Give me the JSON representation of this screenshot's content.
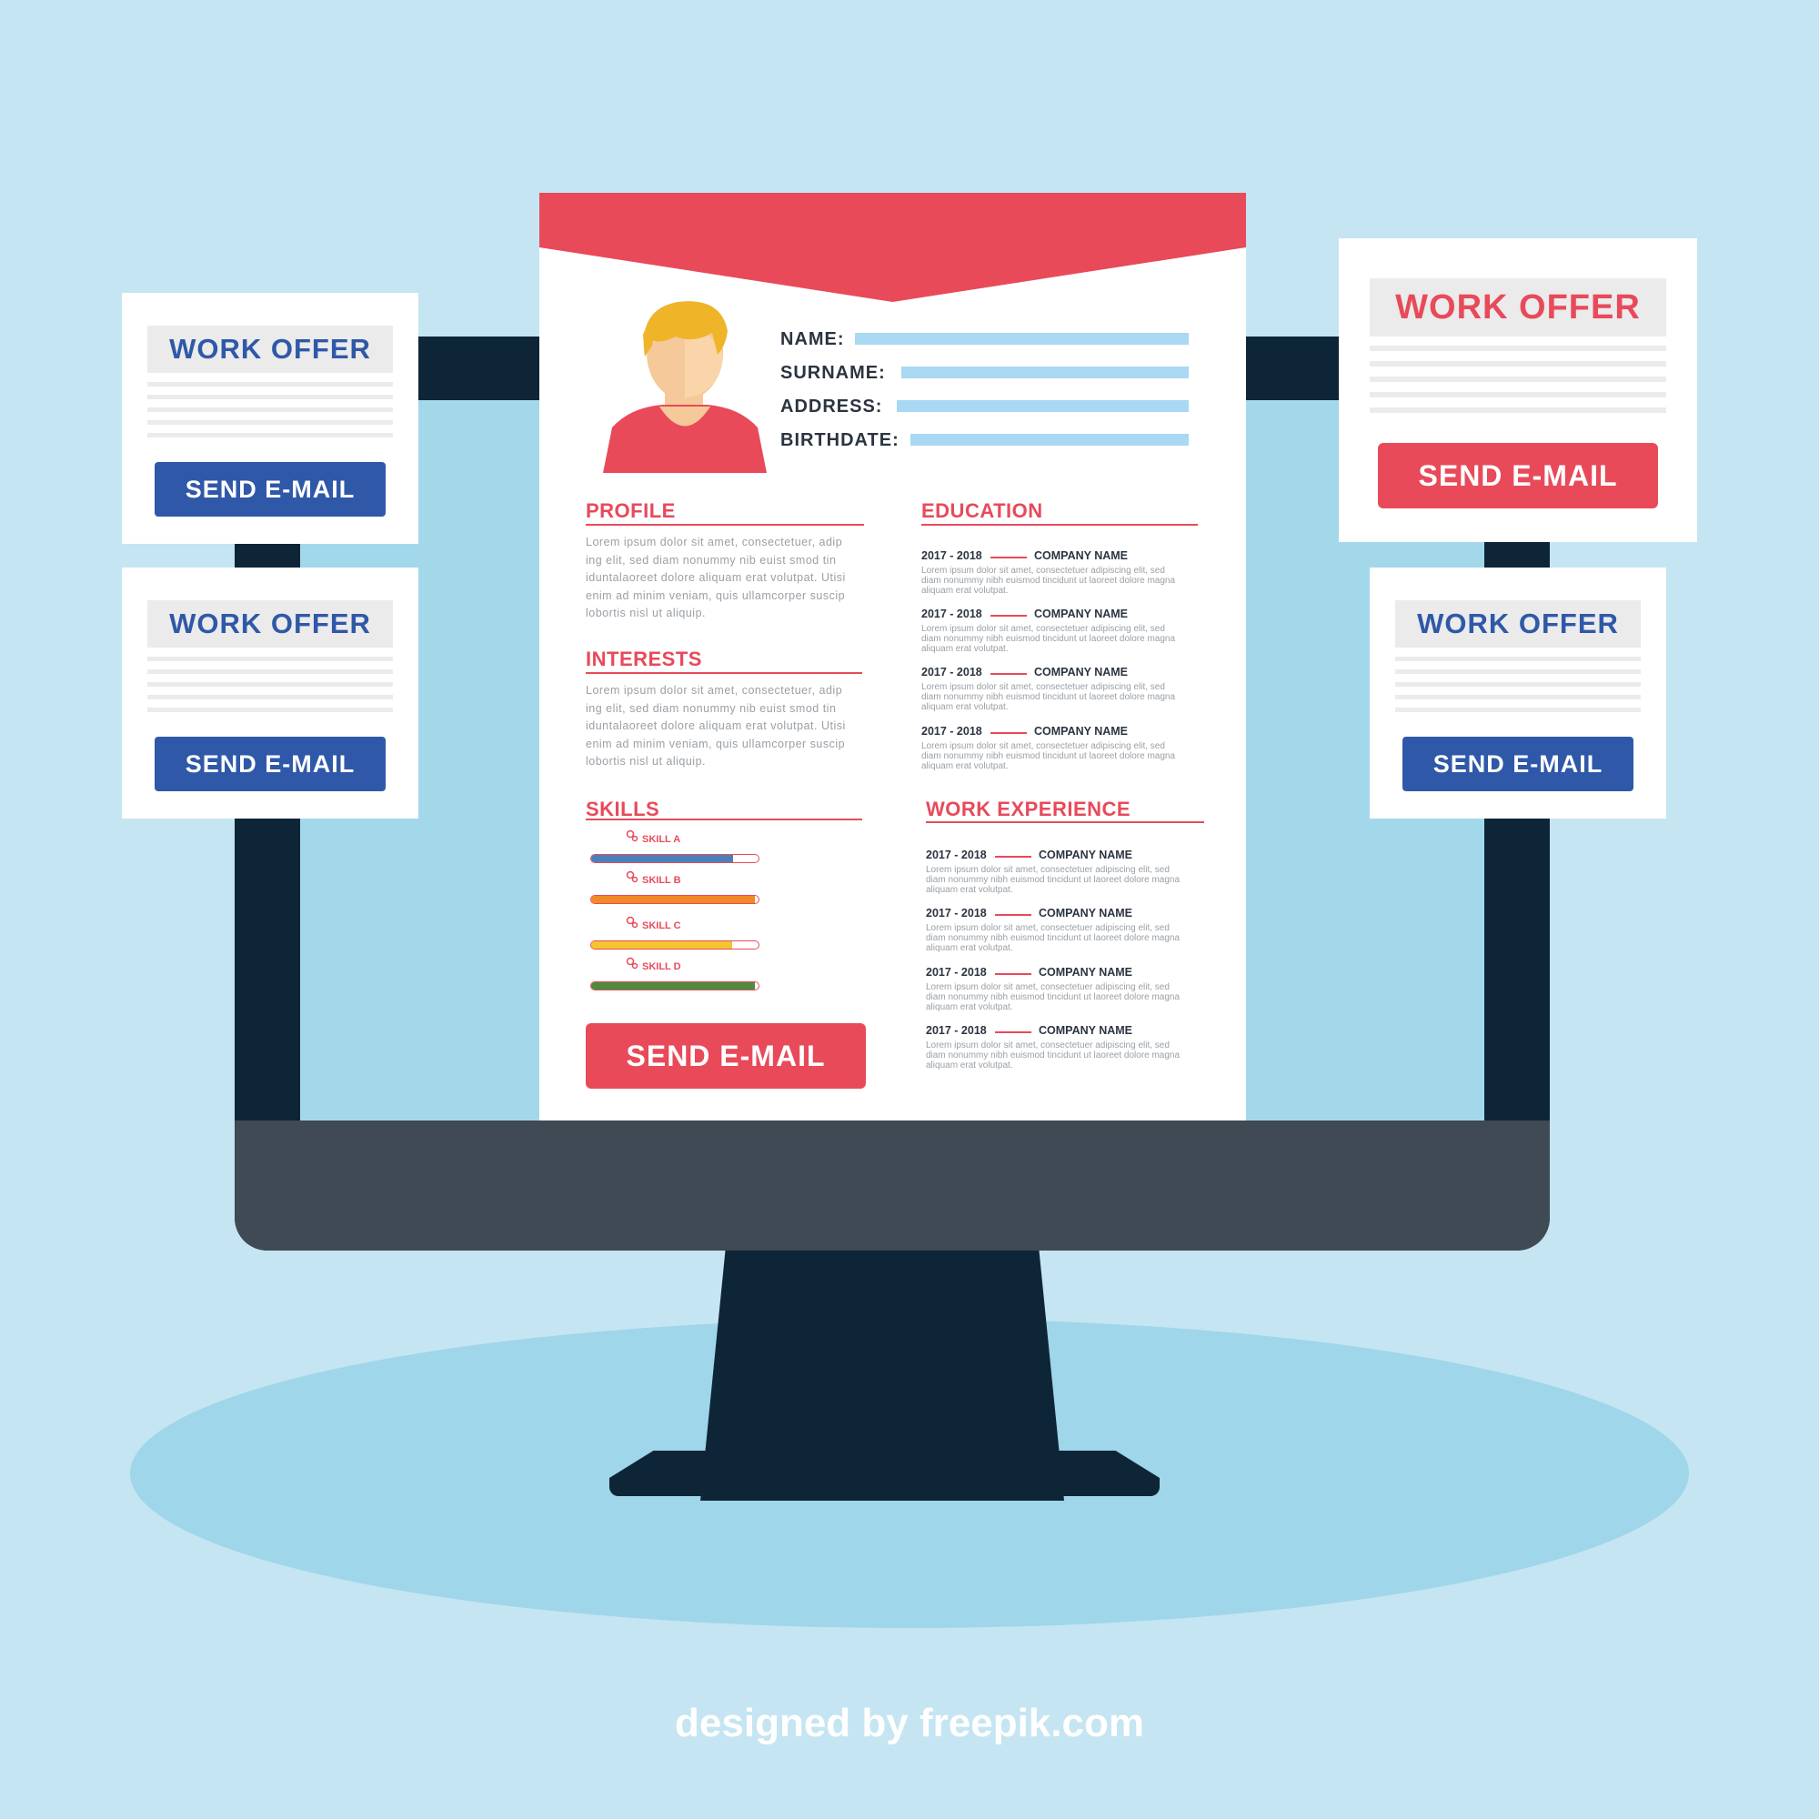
{
  "resume": {
    "fields": [
      {
        "label": "NAME:"
      },
      {
        "label": "SURNAME:"
      },
      {
        "label": "ADDRESS:"
      },
      {
        "label": "BIRTHDATE:"
      }
    ],
    "profile": {
      "title": "PROFILE",
      "lines": [
        "Lorem ipsum dolor sit amet, consectetuer, adip",
        "ing elit, sed diam nonummy nib  euist smod tin",
        "iduntalaoreet dolore aliquam erat volutpat. Utisi",
        "enim ad minim veniam, quis ullamcorper suscip",
        "lobortis nisl ut aliquip."
      ]
    },
    "interests": {
      "title": "INTERESTS",
      "lines": [
        "Lorem ipsum dolor sit amet, consectetuer, adip",
        "ing elit, sed diam nonummy nib  euist smod tin",
        "iduntalaoreet dolore aliquam erat volutpat. Utisi",
        "enim ad minim veniam, quis ullamcorper suscip",
        "lobortis nisl ut aliquip."
      ]
    },
    "skills": {
      "title": "SKILLS",
      "items": [
        {
          "label": "SKILL A",
          "level": 0.85,
          "color": "#4a7fb9"
        },
        {
          "label": "SKILL B",
          "level": 0.98,
          "color": "#f08a24"
        },
        {
          "label": "SKILL C",
          "level": 0.84,
          "color": "#f5c52e"
        },
        {
          "label": "SKILL D",
          "level": 0.98,
          "color": "#4f8a3d"
        }
      ]
    },
    "send_button": "SEND E-MAIL",
    "education": {
      "title": "EDUCATION",
      "entries": [
        {
          "year": "2017 - 2018",
          "company": "COMPANY NAME",
          "desc": "Lorem ipsum dolor sit amet, consectetuer adipiscing elit, sed diam nonummy nibh euismod tincidunt ut laoreet dolore magna aliquam erat volutpat."
        },
        {
          "year": "2017 - 2018",
          "company": "COMPANY NAME",
          "desc": "Lorem ipsum dolor sit amet, consectetuer adipiscing elit, sed diam nonummy nibh euismod tincidunt ut laoreet dolore magna aliquam erat volutpat."
        },
        {
          "year": "2017 - 2018",
          "company": "COMPANY NAME",
          "desc": "Lorem ipsum dolor sit amet, consectetuer adipiscing elit, sed diam nonummy nibh euismod tincidunt ut laoreet dolore magna aliquam erat volutpat."
        },
        {
          "year": "2017 - 2018",
          "company": "COMPANY NAME",
          "desc": "Lorem ipsum dolor sit amet, consectetuer adipiscing elit, sed diam nonummy nibh euismod tincidunt ut laoreet dolore magna aliquam erat volutpat."
        }
      ]
    },
    "work": {
      "title": "WORK EXPERIENCE",
      "entries": [
        {
          "year": "2017 - 2018",
          "company": "COMPANY NAME",
          "desc": "Lorem ipsum dolor sit amet, consectetuer adipiscing elit, sed diam nonummy nibh euismod tincidunt ut laoreet dolore magna aliquam erat volutpat."
        },
        {
          "year": "2017 - 2018",
          "company": "COMPANY NAME",
          "desc": "Lorem ipsum dolor sit amet, consectetuer adipiscing elit, sed diam nonummy nibh euismod tincidunt ut laoreet dolore magna aliquam erat volutpat."
        },
        {
          "year": "2017 - 2018",
          "company": "COMPANY NAME",
          "desc": "Lorem ipsum dolor sit amet, consectetuer adipiscing elit, sed diam nonummy nibh euismod tincidunt ut laoreet dolore magna aliquam erat volutpat."
        },
        {
          "year": "2017 - 2018",
          "company": "COMPANY NAME",
          "desc": "Lorem ipsum dolor sit amet, consectetuer adipiscing elit, sed diam nonummy nibh euismod tincidunt ut laoreet dolore magna aliquam erat volutpat."
        }
      ]
    }
  },
  "offers": [
    {
      "title": "WORK OFFER",
      "button": "SEND E-MAIL",
      "accent": "#2f58a8"
    },
    {
      "title": "WORK OFFER",
      "button": "SEND E-MAIL",
      "accent": "#2f58a8"
    },
    {
      "title": "WORK OFFER",
      "button": "SEND E-MAIL",
      "accent": "#e84a5a"
    },
    {
      "title": "WORK OFFER",
      "button": "SEND E-MAIL",
      "accent": "#2f58a8"
    }
  ],
  "credit": "designed by freepik.com",
  "colors": {
    "accent_red": "#e84a5a",
    "accent_blue": "#2f58a8",
    "monitor": "#0e2537",
    "background": "#c5e5f2"
  }
}
